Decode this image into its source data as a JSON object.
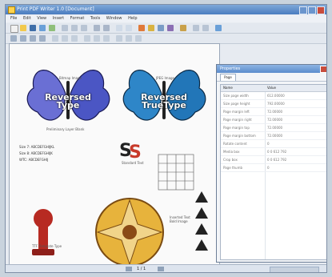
{
  "window": {
    "title": "Print PDF Writer 1.0 [Document]"
  },
  "menu": [
    "File",
    "Edit",
    "View",
    "Insert",
    "Format",
    "Tools",
    "Window",
    "Help"
  ],
  "canvas": {
    "left_wing_caption": "Bitmap Image",
    "right_wing_caption": "JPEG Image",
    "reversed_type": "Reversed\nType",
    "reversed_truetype": "Reversed\nTrueType",
    "layer_label": "Preliminary Layer Blank",
    "ss_letters": "SS",
    "ss_caption": "Standard Text",
    "sample_lines": [
      "Size 7: ABCDEFGHIJKL",
      "Size 8: ABCDEFGHIJK",
      "WTC: ABCDEFGHIJ"
    ],
    "pawn_caption": "TTF Template Type",
    "bottom_caption": "Inserted Text Bold Image"
  },
  "panel": {
    "title": "Properties",
    "tab": "Page",
    "col_name": "Name",
    "col_value": "Value",
    "rows": [
      {
        "k": "Size page width",
        "v": "612.00000"
      },
      {
        "k": "Size page height",
        "v": "792.00000"
      },
      {
        "k": "Page margin left",
        "v": "72.00000"
      },
      {
        "k": "Page margin right",
        "v": "72.00000"
      },
      {
        "k": "Page margin top",
        "v": "72.00000"
      },
      {
        "k": "Page margin bottom",
        "v": "72.00000"
      },
      {
        "k": "Rotate content",
        "v": "0"
      },
      {
        "k": "Media box",
        "v": "0 0 612 792"
      },
      {
        "k": "Crop box",
        "v": "0 0 612 792"
      },
      {
        "k": "Page thumb",
        "v": "0"
      }
    ]
  },
  "statusbar": {
    "page": "1 / 1"
  }
}
